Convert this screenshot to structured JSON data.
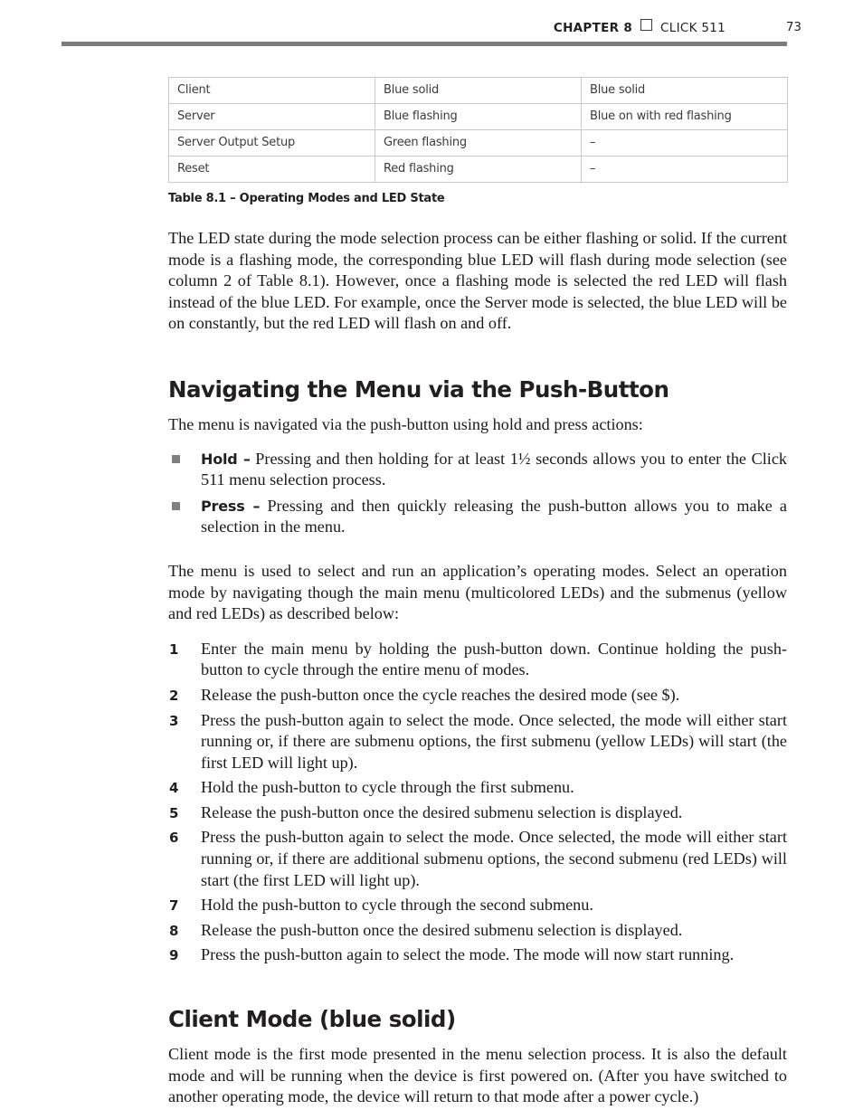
{
  "header": {
    "chapter": "CHAPTER 8",
    "separator_icon": "square-outline-icon",
    "product": "CLICK 511",
    "page_number": "73"
  },
  "table": {
    "caption": "Table 8.1 – Operating Modes and LED State",
    "rows": [
      {
        "mode": "Client",
        "selection_led": "Blue solid",
        "running_led": "Blue solid"
      },
      {
        "mode": "Server",
        "selection_led": "Blue flashing",
        "running_led": "Blue on with red flashing"
      },
      {
        "mode": "Server Output Setup",
        "selection_led": "Green flashing",
        "running_led": "–"
      },
      {
        "mode": "Reset",
        "selection_led": "Red flashing",
        "running_led": "–"
      }
    ]
  },
  "paragraphs": {
    "led_state": "The LED state during the mode selection process can be either flashing or solid. If the current mode is a flashing mode, the corresponding blue LED will flash during mode selection (see column 2 of Table 8.1). However, once a flashing mode is selected the red LED will flash instead of the blue LED. For example, once the Server mode is selected, the blue LED will be on constantly, but the red LED will flash on and off.",
    "menu_intro": "The menu is navigated via the push-button using hold and press actions:",
    "menu_usage": "The menu is used to select and run an application’s operating modes. Select an operation mode by navigating though the main menu (multicolored LEDs) and the submenus (yellow and red LEDs) as described below:",
    "client_mode_body": "Client mode is the first mode presented in the menu selection process. It is also the default mode and will be running when the device is first powered on. (After you have switched to another operating mode, the device will return to that mode after a power cycle.)"
  },
  "headings": {
    "navigating": "Navigating the Menu via the Push-Button",
    "client_mode": "Client Mode (blue solid)"
  },
  "actions": [
    {
      "label": "Hold –",
      "text": " Pressing and then holding for at least 1½ seconds allows you to enter the Click 511 menu selection process."
    },
    {
      "label": "Press –",
      "text": " Pressing and then quickly releasing the push-button allows you to make a selection in the menu."
    }
  ],
  "steps": [
    {
      "number": "1",
      "text": "Enter the main menu by holding the push-button down. Continue holding the push-button to cycle through the entire menu of modes."
    },
    {
      "number": "2",
      "text": "Release the push-button once the cycle reaches the desired mode (see $)."
    },
    {
      "number": "3",
      "text": "Press the push-button again to select the mode. Once selected, the mode will either start running or, if there are submenu options, the first submenu (yellow LEDs) will start (the first LED will light up)."
    },
    {
      "number": "4",
      "text": "Hold the push-button to cycle through the first submenu."
    },
    {
      "number": "5",
      "text": "Release the push-button once the desired submenu selection is displayed."
    },
    {
      "number": "6",
      "text": "Press the push-button again to select the mode. Once selected, the mode will either start running or, if there are additional submenu options, the second submenu (red LEDs) will start (the first LED will light up)."
    },
    {
      "number": "7",
      "text": "Hold the push-button to cycle through the second submenu."
    },
    {
      "number": "8",
      "text": "Release the push-button once the desired submenu selection is displayed."
    },
    {
      "number": "9",
      "text": "Press the push-button again to select the mode. The mode will now start running."
    }
  ],
  "colors": {
    "rule": "#7c7c7c",
    "bullet_square": "#808080",
    "table_border": "#c9c9c9",
    "text": "#1a1a1a"
  }
}
